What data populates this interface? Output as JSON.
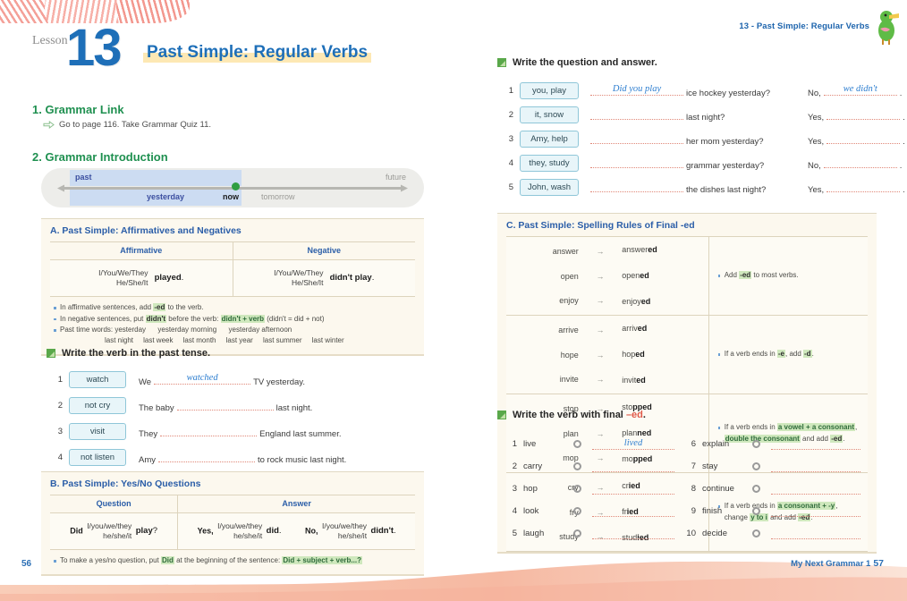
{
  "runninghead": {
    "text": "13 - Past Simple: Regular Verbs",
    "mascot": "bird-mascot-icon"
  },
  "lesson": {
    "word": "Lesson",
    "number": "13",
    "title": "Past Simple: Regular Verbs"
  },
  "sections": {
    "grammar_link": {
      "heading": "1. Grammar Link",
      "link_text": "Go to page 116. Take Grammar Quiz 11."
    },
    "grammar_intro": {
      "heading": "2. Grammar Introduction"
    }
  },
  "timeline": {
    "past": "past",
    "future": "future",
    "yesterday": "yesterday",
    "now": "now",
    "tomorrow": "tomorrow"
  },
  "box_a": {
    "title": "A. Past Simple: Affirmatives and Negatives",
    "headers": [
      "Affirmative",
      "Negative"
    ],
    "affirmative": {
      "subjects": [
        "I/You/We/They",
        "He/She/It"
      ],
      "verb": "played",
      "punct": "."
    },
    "negative": {
      "subjects": [
        "I/You/We/They",
        "He/She/It"
      ],
      "verb": "didn't play",
      "punct": "."
    },
    "notes": [
      {
        "parts": [
          {
            "t": "In affirmative sentences, add ",
            "s": "plain"
          },
          {
            "t": "-ed",
            "s": "hl"
          },
          {
            "t": " to the verb.",
            "s": "plain"
          }
        ]
      },
      {
        "parts": [
          {
            "t": "In negative sentences, put ",
            "s": "plain"
          },
          {
            "t": "didn't",
            "s": "hl"
          },
          {
            "t": " before the verb: ",
            "s": "plain"
          },
          {
            "t": "didn't + verb",
            "s": "hlg"
          },
          {
            "t": " (didn't = did + not)",
            "s": "plain"
          }
        ]
      },
      {
        "parts": [
          {
            "t": "Past time words: yesterday      yesterday morning      yesterday afternoon",
            "s": "plain"
          }
        ]
      }
    ],
    "time_words_line2": "last night     last week     last month     last year     last summer     last winter"
  },
  "exercise_1": {
    "heading": "Write the verb in the past tense.",
    "items": [
      {
        "n": "1",
        "cue": "watch",
        "pre": "We",
        "answer": "watched",
        "post": "TV yesterday."
      },
      {
        "n": "2",
        "cue": "not cry",
        "pre": "The baby",
        "answer": "",
        "post": "last night."
      },
      {
        "n": "3",
        "cue": "visit",
        "pre": "They",
        "answer": "",
        "post": "England last summer."
      },
      {
        "n": "4",
        "cue": "not listen",
        "pre": "Amy",
        "answer": "",
        "post": "to rock music last night."
      }
    ]
  },
  "box_b": {
    "title": "B. Past Simple: Yes/No Questions",
    "headers": [
      "Question",
      "Answer"
    ],
    "question": {
      "lead": "Did",
      "subjects": [
        "I/you/we/they",
        "he/she/it"
      ],
      "verb": "play",
      "punct": "?"
    },
    "answer_yes": {
      "lead": "Yes,",
      "subjects": [
        "I/you/we/they",
        "he/she/it"
      ],
      "verb": "did",
      "punct": "."
    },
    "answer_no": {
      "lead": "No,",
      "subjects": [
        "I/you/we/they",
        "he/she/it"
      ],
      "verb": "didn't",
      "punct": "."
    },
    "notes": [
      {
        "parts": [
          {
            "t": "To make a yes/no question, put ",
            "s": "plain"
          },
          {
            "t": "Did",
            "s": "hlg"
          },
          {
            "t": " at the beginning of the sentence: ",
            "s": "plain"
          },
          {
            "t": "Did + subject + verb...?",
            "s": "hlg"
          }
        ]
      }
    ]
  },
  "exercise_2": {
    "heading": "Write the question and answer.",
    "items": [
      {
        "n": "1",
        "cue": "you, play",
        "q_answer": "Did you play",
        "q_rest": "ice hockey yesterday?",
        "a_lead": "No,",
        "a_answer": "we didn't"
      },
      {
        "n": "2",
        "cue": "it, snow",
        "q_answer": "",
        "q_rest": "last night?",
        "a_lead": "Yes,",
        "a_answer": ""
      },
      {
        "n": "3",
        "cue": "Amy, help",
        "q_answer": "",
        "q_rest": "her mom yesterday?",
        "a_lead": "Yes,",
        "a_answer": ""
      },
      {
        "n": "4",
        "cue": "they, study",
        "q_answer": "",
        "q_rest": "grammar yesterday?",
        "a_lead": "No,",
        "a_answer": ""
      },
      {
        "n": "5",
        "cue": "John, wash",
        "q_answer": "",
        "q_rest": "the dishes last night?",
        "a_lead": "Yes,",
        "a_answer": ""
      }
    ]
  },
  "box_c": {
    "title": "C. Past Simple: Spelling Rules of Final -ed",
    "groups": [
      {
        "pairs": [
          {
            "base": "answer",
            "past_stem": "answer",
            "past_suffix": "ed"
          },
          {
            "base": "open",
            "past_stem": "open",
            "past_suffix": "ed"
          },
          {
            "base": "enjoy",
            "past_stem": "enjoy",
            "past_suffix": "ed"
          }
        ],
        "rule_parts": [
          {
            "t": "Add ",
            "s": "plain"
          },
          {
            "t": "-ed",
            "s": "hl"
          },
          {
            "t": " to most verbs.",
            "s": "plain"
          }
        ]
      },
      {
        "pairs": [
          {
            "base": "arrive",
            "past_stem": "arriv",
            "past_suffix": "ed"
          },
          {
            "base": "hope",
            "past_stem": "hop",
            "past_suffix": "ed"
          },
          {
            "base": "invite",
            "past_stem": "invit",
            "past_suffix": "ed"
          }
        ],
        "rule_parts": [
          {
            "t": "If a verb ends in ",
            "s": "plain"
          },
          {
            "t": "-e",
            "s": "hl"
          },
          {
            "t": ", add ",
            "s": "plain"
          },
          {
            "t": "-d",
            "s": "hl"
          },
          {
            "t": ".",
            "s": "plain"
          }
        ]
      },
      {
        "pairs": [
          {
            "base": "stop",
            "past_stem": "sto",
            "past_suffix": "pped"
          },
          {
            "base": "plan",
            "past_stem": "plan",
            "past_suffix": "ned"
          },
          {
            "base": "mop",
            "past_stem": "mo",
            "past_suffix": "pped"
          }
        ],
        "rule_parts": [
          {
            "t": "If a verb ends in ",
            "s": "plain"
          },
          {
            "t": "a vowel + a consonant",
            "s": "hlg"
          },
          {
            "t": ",",
            "s": "plain"
          },
          {
            "t": "BR",
            "s": "br"
          },
          {
            "t": "double the consonant",
            "s": "hlg"
          },
          {
            "t": " and add ",
            "s": "plain"
          },
          {
            "t": "-ed",
            "s": "hl"
          },
          {
            "t": ".",
            "s": "plain"
          }
        ]
      },
      {
        "pairs": [
          {
            "base": "cry",
            "past_stem": "cr",
            "past_suffix": "ied"
          },
          {
            "base": "fry",
            "past_stem": "fr",
            "past_suffix": "ied"
          },
          {
            "base": "study",
            "past_stem": "stud",
            "past_suffix": "ied"
          }
        ],
        "rule_parts": [
          {
            "t": "If a verb ends in ",
            "s": "plain"
          },
          {
            "t": "a consonant + -y",
            "s": "hlg"
          },
          {
            "t": ",",
            "s": "plain"
          },
          {
            "t": "BR",
            "s": "br"
          },
          {
            "t": "change ",
            "s": "plain"
          },
          {
            "t": "y to i",
            "s": "hlg"
          },
          {
            "t": " and add ",
            "s": "plain"
          },
          {
            "t": "-ed",
            "s": "hl"
          },
          {
            "t": ".",
            "s": "plain"
          }
        ]
      }
    ],
    "arrow": "→"
  },
  "exercise_3": {
    "heading_pre": "Write the verb with final ",
    "heading_em": "–ed",
    "heading_post": ".",
    "left_items": [
      {
        "n": "1",
        "verb": "live",
        "answer": "lived"
      },
      {
        "n": "2",
        "verb": "carry",
        "answer": ""
      },
      {
        "n": "3",
        "verb": "hop",
        "answer": ""
      },
      {
        "n": "4",
        "verb": "look",
        "answer": ""
      },
      {
        "n": "5",
        "verb": "laugh",
        "answer": ""
      }
    ],
    "right_items": [
      {
        "n": "6",
        "verb": "explain",
        "answer": ""
      },
      {
        "n": "7",
        "verb": "stay",
        "answer": ""
      },
      {
        "n": "8",
        "verb": "continue",
        "answer": ""
      },
      {
        "n": "9",
        "verb": "finish",
        "answer": ""
      },
      {
        "n": "10",
        "verb": "decide",
        "answer": ""
      }
    ]
  },
  "footer": {
    "page_left": "56",
    "book": "My Next Grammar 1",
    "page_right": "57"
  },
  "colors": {
    "brand_blue": "#1e6fb8",
    "green": "#1f9050",
    "highlight_yellow": "#fde8b4",
    "highlight_green": "#cfe8bd",
    "box_cream": "#fcf8ee",
    "cue_blue": "#e8f5f9",
    "handwriting": "#2f7fd0",
    "blank_line": "#e08878",
    "wave_pink": "#f6b9a2"
  }
}
